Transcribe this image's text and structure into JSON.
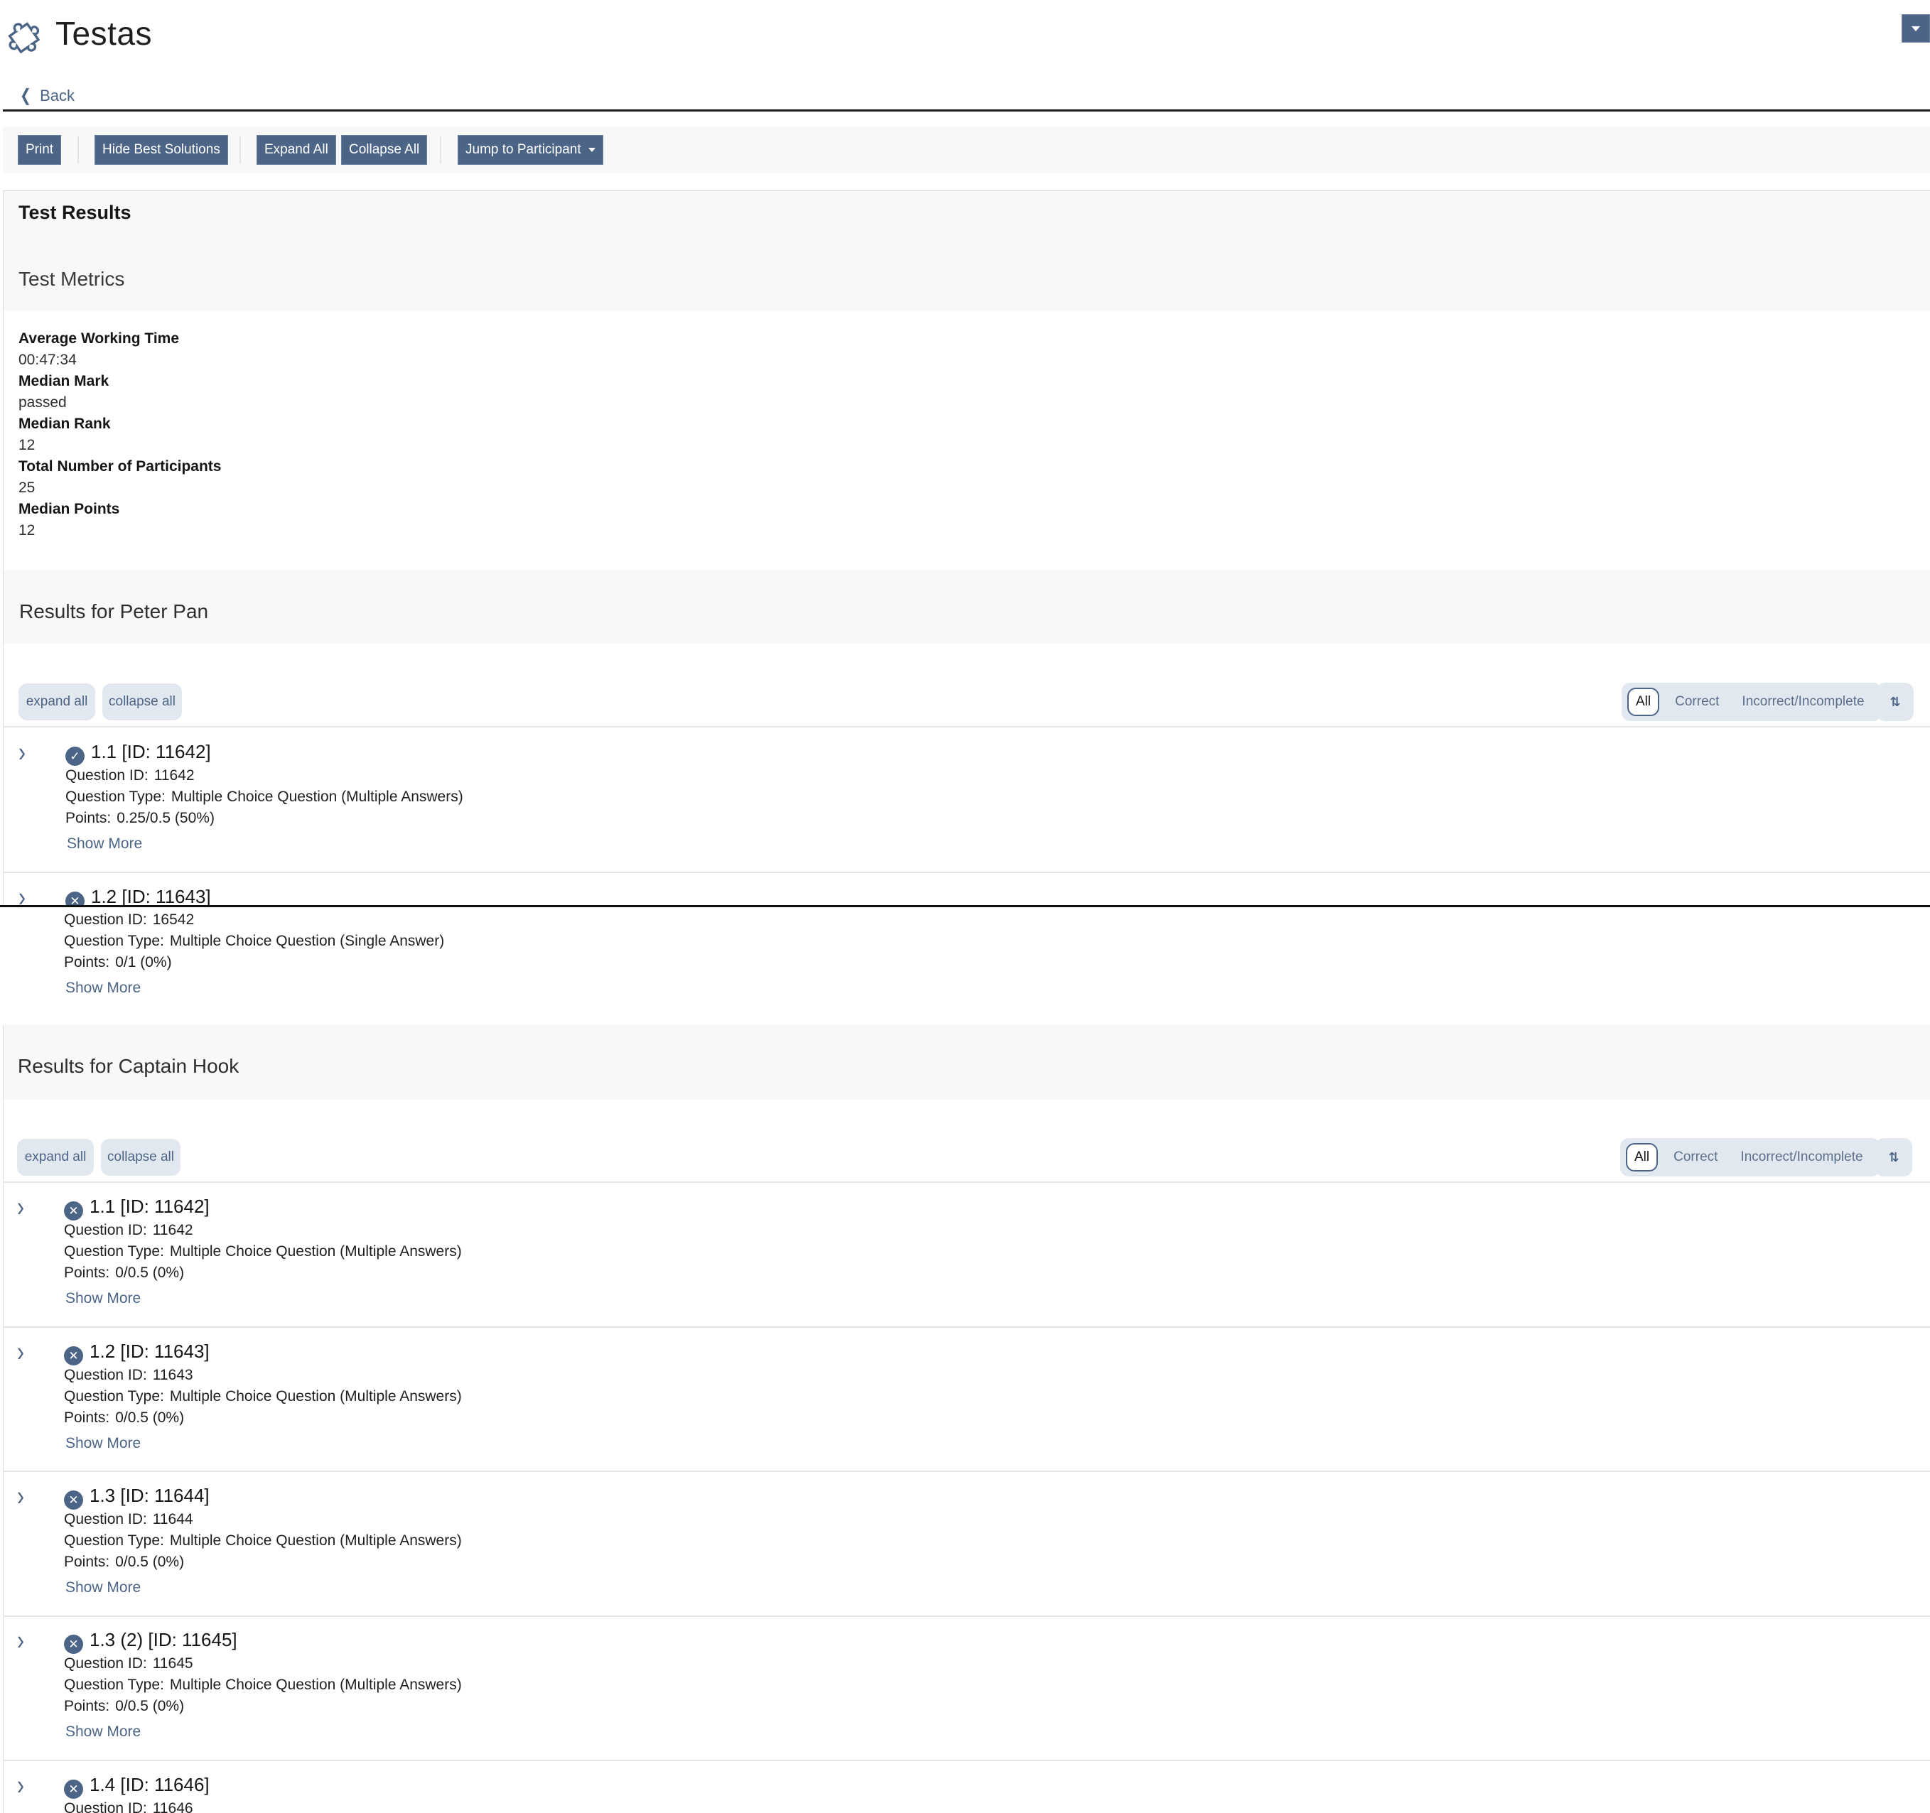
{
  "header": {
    "app_title": "Testas",
    "logo_icon": "puzzle-icon",
    "user_menu_icon": "caret-down-icon",
    "back_label": "Back"
  },
  "toolbar": {
    "print": "Print",
    "hide_best_solutions": "Hide Best Solutions",
    "expand_all": "Expand All",
    "collapse_all": "Collapse All",
    "jump_to_participant": "Jump to Participant"
  },
  "results": {
    "title": "Test Results",
    "metrics_title": "Test Metrics",
    "metrics": [
      {
        "label": "Average Working Time",
        "value": "00:47:34"
      },
      {
        "label": "Median Mark",
        "value": "passed"
      },
      {
        "label": "Median Rank",
        "value": "12"
      },
      {
        "label": "Total Number of Participants",
        "value": "25"
      },
      {
        "label": "Median Points",
        "value": "12"
      }
    ]
  },
  "list_controls": {
    "expand_all": "expand all",
    "collapse_all": "collapse all",
    "filters": [
      "All",
      "Correct",
      "Incorrect/Incomplete"
    ],
    "active_filter": "All",
    "sort_icon": "sort-arrows-icon",
    "show_more": "Show More",
    "label_question_id": "Question ID:",
    "label_question_type": "Question Type:",
    "label_points": "Points:"
  },
  "participants": [
    {
      "heading": "Results for Peter Pan",
      "items": [
        {
          "title": "1.1 [ID: 11642]",
          "status": "correct",
          "question_id": "11642",
          "question_type": "Multiple Choice Question (Multiple Answers)",
          "points": "0.25/0.5 (50%)"
        },
        {
          "title": "1.2 [ID: 11643]",
          "status": "incorrect",
          "question_id": "16542",
          "question_type": "Multiple Choice Question (Single Answer)",
          "points": "0/1 (0%)"
        }
      ]
    },
    {
      "heading": "Results for Captain Hook",
      "items": [
        {
          "title": "1.1 [ID: 11642]",
          "status": "incorrect",
          "question_id": "11642",
          "question_type": "Multiple Choice Question (Multiple Answers)",
          "points": "0/0.5 (0%)"
        },
        {
          "title": "1.2 [ID: 11643]",
          "status": "incorrect",
          "question_id": "11643",
          "question_type": "Multiple Choice Question (Multiple Answers)",
          "points": "0/0.5 (0%)"
        },
        {
          "title": "1.3 [ID: 11644]",
          "status": "incorrect",
          "question_id": "11644",
          "question_type": "Multiple Choice Question (Multiple Answers)",
          "points": "0/0.5 (0%)"
        },
        {
          "title": "1.3 (2) [ID: 11645]",
          "status": "incorrect",
          "question_id": "11645",
          "question_type": "Multiple Choice Question (Multiple Answers)",
          "points": "0/0.5 (0%)"
        },
        {
          "title": "1.4 [ID: 11646]",
          "status": "incorrect",
          "question_id": "11646"
        }
      ]
    }
  ],
  "colors": {
    "accent": "#4c6586",
    "pill_bg": "#e2e8ef",
    "band_bg": "#f8f8f8"
  }
}
